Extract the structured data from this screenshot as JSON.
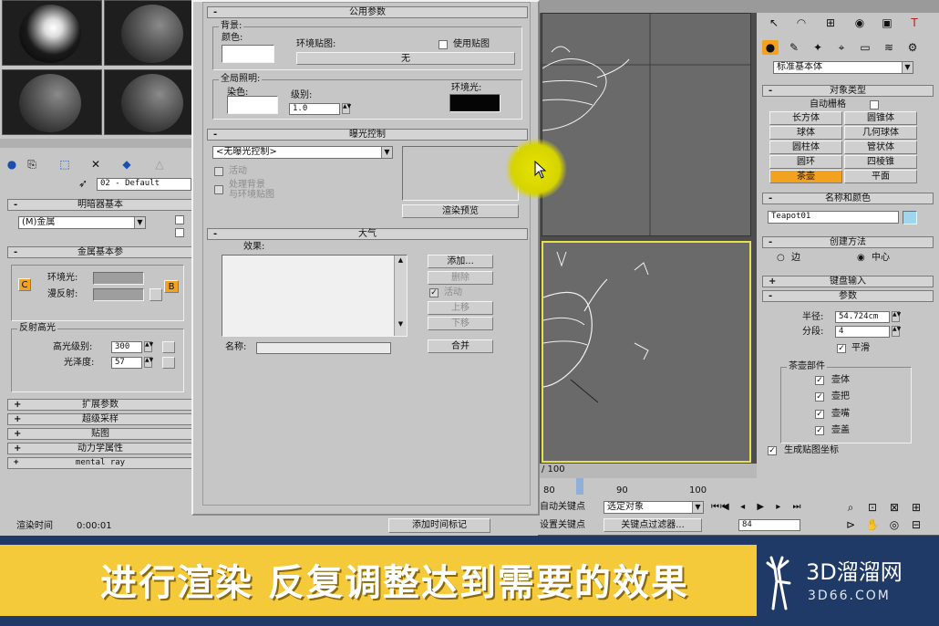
{
  "viewport_panel": {
    "timeline_counter": "/ 100",
    "ticks": [
      "80",
      "90",
      "100"
    ]
  },
  "material_editor": {
    "toolbar_field": "02 - Default",
    "shader_rollout": "明暗器基本",
    "shader_type": "(M)金属",
    "metal_rollout": "金属基本参",
    "ambient_label": "环境光:",
    "diffuse_label": "漫反射:",
    "c_label": "C",
    "b_label": "B",
    "specular_group": "反射高光",
    "spec_level_label": "高光级别:",
    "spec_level_value": "300",
    "gloss_label": "光泽度:",
    "gloss_value": "57",
    "rollouts": [
      "扩展参数",
      "超级采样",
      "贴图",
      "动力学属性",
      "mental ray"
    ]
  },
  "render_env": {
    "common_title": "公用参数",
    "background_group": "背景:",
    "color_label": "颜色:",
    "env_map_label": "环境贴图:",
    "use_map_label": "使用贴图",
    "env_map_value": "无",
    "global_light_group": "全局照明:",
    "tint_label": "染色:",
    "level_label": "级别:",
    "level_value": "1.0",
    "ambient_label": "环境光:",
    "exposure_title": "曝光控制",
    "exposure_select": "<无曝光控制>",
    "active_label": "活动",
    "process_bg_label": "处理背景\n与环境贴图",
    "render_preview_button": "渲染预览",
    "atmosphere_title": "大气",
    "effects_label": "效果:",
    "add_button": "添加...",
    "delete_button": "删除",
    "atm_active_label": "活动",
    "move_up_button": "上移",
    "move_down_button": "下移",
    "name_label": "名称:",
    "merge_button": "合并"
  },
  "command_panel": {
    "category_select": "标准基本体",
    "object_type_title": "对象类型",
    "autogrid_label": "自动栅格",
    "buttons": [
      "长方体",
      "圆锥体",
      "球体",
      "几何球体",
      "圆柱体",
      "管状体",
      "圆环",
      "四棱锥",
      "茶壶",
      "平面"
    ],
    "active_button": "茶壶",
    "name_color_title": "名称和颜色",
    "object_name": "Teapot01",
    "creation_method_title": "创建方法",
    "edge_label": "边",
    "center_label": "中心",
    "keyboard_entry_title": "键盘输入",
    "params_title": "参数",
    "radius_label": "半径:",
    "radius_value": "54.724cm",
    "segments_label": "分段:",
    "segments_value": "4",
    "smooth_label": "平滑",
    "parts_group": "茶壶部件",
    "parts": [
      "壶体",
      "壶把",
      "壶嘴",
      "壶盖"
    ],
    "gen_map_coords_label": "生成贴图坐标",
    "object_color": "#9fd6ee"
  },
  "bottom_bar": {
    "render_time_label": "渲染时间",
    "render_time_value": "0:00:01",
    "add_time_tag": "添加时间标记",
    "auto_key_label": "自动关键点",
    "selected_object_select": "选定对象",
    "set_key_label": "设置关键点",
    "key_filters_button": "关键点过滤器...",
    "frame_value": "84"
  },
  "caption": {
    "text": "进行渲染 反复调整达到需要的效果",
    "logo_cn": "3D溜溜网",
    "logo_url": "3D66.COM"
  },
  "colors": {
    "caption_bg": "#f4c93a",
    "cursor_highlight": "#e3e000",
    "active_orange": "#f2a21f",
    "viewport_selected_border": "#e7e24a"
  }
}
